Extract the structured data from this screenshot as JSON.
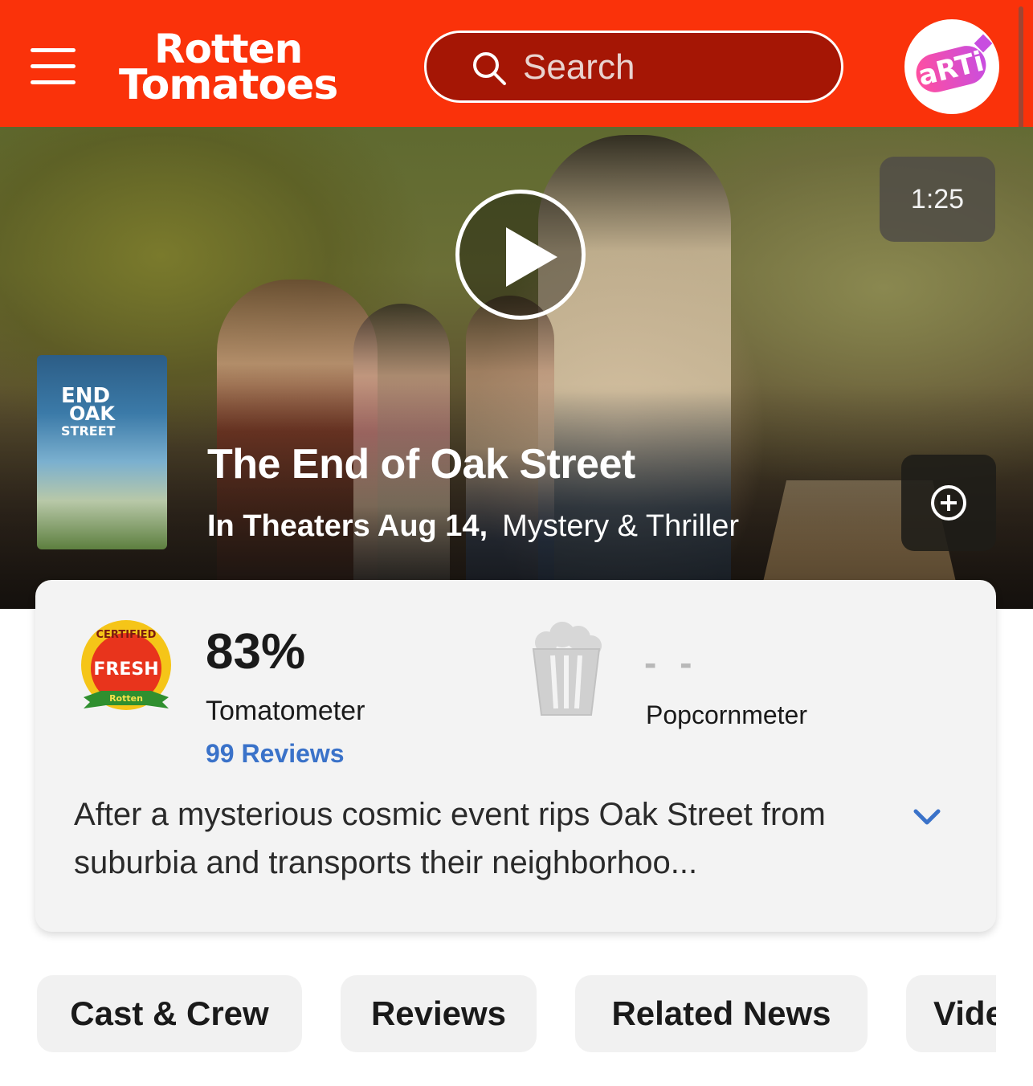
{
  "header": {
    "logo_line1": "Rotten",
    "logo_line2": "Tomatoes",
    "search_placeholder": "Search",
    "avatar_text": "aRTi"
  },
  "hero": {
    "video_duration": "1:25",
    "poster_title_line1": "END",
    "poster_title_line2": "OAK",
    "poster_title_line3": "STREET",
    "title": "The End of Oak Street",
    "release": "In Theaters Aug 14,",
    "genre": "Mystery & Thriller"
  },
  "scores": {
    "badge_top_text": "CERTIFIED",
    "badge_main_text": "FRESH",
    "tomatometer_value": "83%",
    "tomatometer_label": "Tomatometer",
    "reviews_link": "99 Reviews",
    "popcornmeter_value": "- -",
    "popcornmeter_label": "Popcornmeter"
  },
  "synopsis": "After a mysterious cosmic event rips Oak Street from suburbia and transports their neighborhoo...",
  "tabs": [
    {
      "label": "Cast & Crew"
    },
    {
      "label": "Reviews"
    },
    {
      "label": "Related News"
    },
    {
      "label": "Vide"
    }
  ],
  "colors": {
    "brand_red": "#fa320a",
    "link_blue": "#3a72c9",
    "card_bg": "#f3f3f3"
  },
  "icons": [
    "menu-icon",
    "search-icon",
    "play-icon",
    "add-circle-icon",
    "certified-fresh-icon",
    "popcorn-bucket-icon",
    "chevron-down-icon"
  ]
}
